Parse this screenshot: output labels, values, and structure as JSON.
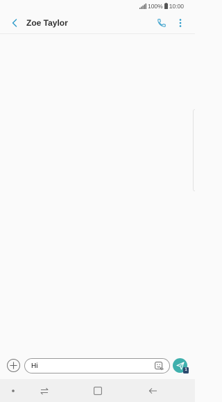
{
  "status_bar": {
    "battery": "100%",
    "time": "10:00"
  },
  "header": {
    "contact_name": "Zoe Taylor"
  },
  "composer": {
    "message_value": "Hi",
    "sim_badge": "1"
  },
  "colors": {
    "accent": "#3fb0ad",
    "header_icon": "#2c9ac9",
    "sim_badge": "#2c4a6e"
  },
  "icons": {
    "back": "chevron-left-icon",
    "call": "phone-icon",
    "more": "more-vertical-icon",
    "attach": "plus-icon",
    "sticker": "sticker-icon",
    "send": "send-icon",
    "nav_dot": "dot-icon",
    "nav_recents": "recents-icon",
    "nav_home": "home-icon",
    "nav_back": "back-arrow-icon"
  }
}
